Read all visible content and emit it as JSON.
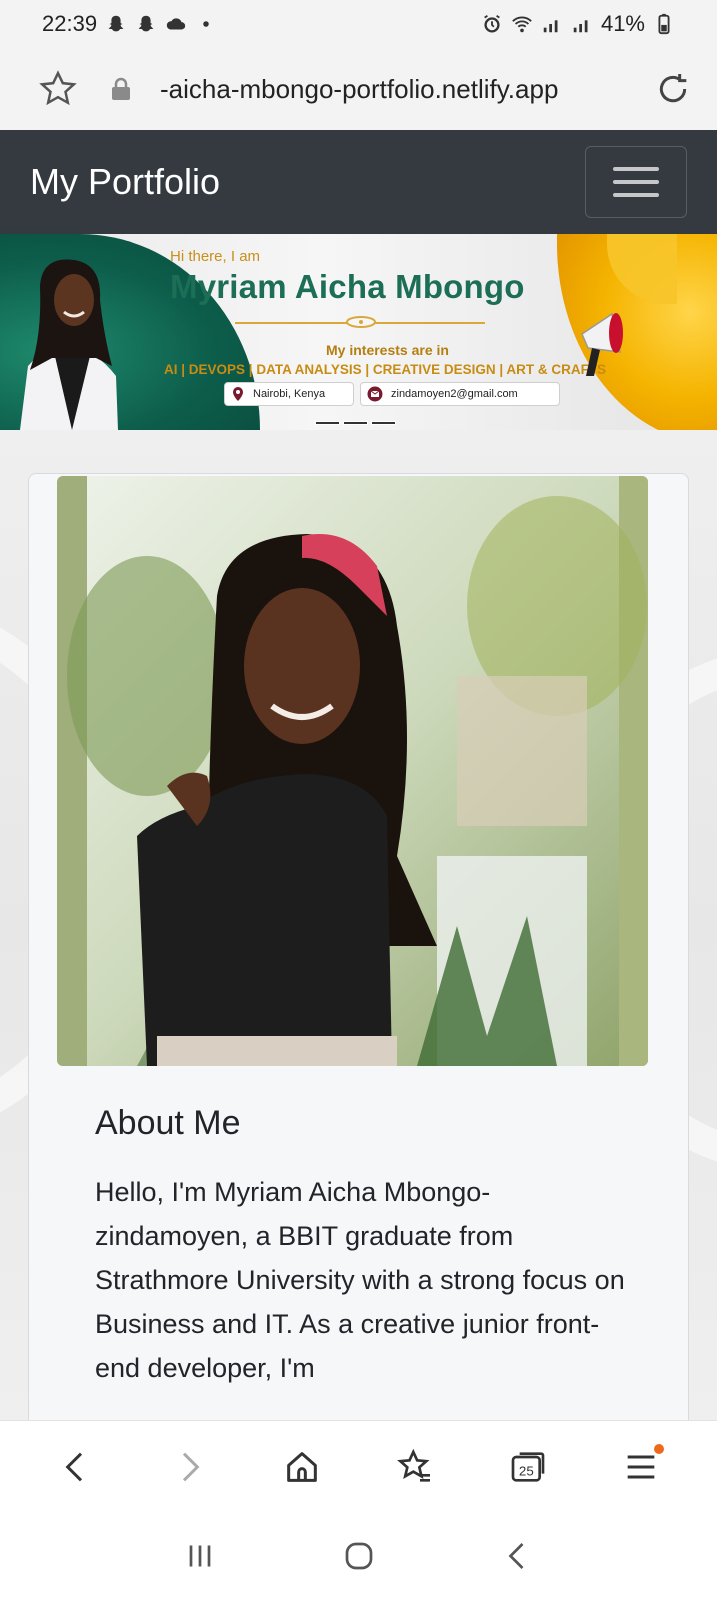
{
  "status_bar": {
    "time": "22:39",
    "battery": "41%"
  },
  "url_bar": {
    "url": "-aicha-mbongo-portfolio.netlify.app"
  },
  "navbar": {
    "brand": "My Portfolio"
  },
  "banner": {
    "greeting": "Hi there, I am",
    "name": "Myriam Aicha Mbongo",
    "interests_label": "My interests are in",
    "interests": "AI | DEVOPS | DATA ANALYSIS | CREATIVE DESIGN | ART & CRAFTS",
    "location": "Nairobi, Kenya",
    "email": "zindamoyen2@gmail.com"
  },
  "about": {
    "title": "About Me",
    "text": "Hello, I'm Myriam Aicha Mbongo-zindamoyen, a BBIT graduate from Strathmore University with a strong focus on Business and IT. As a creative junior front-end developer, I'm"
  },
  "bottom_bar": {
    "tabs_count": "25"
  },
  "colors": {
    "navbar_bg": "#343a40",
    "banner_green": "#1c6e56",
    "banner_gold": "#f5b400",
    "menu_badge": "#ee6a1b"
  }
}
